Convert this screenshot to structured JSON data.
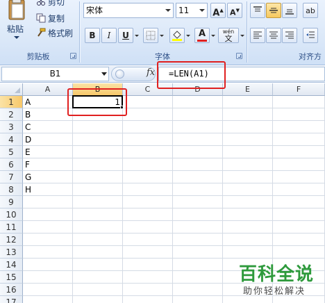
{
  "ribbon": {
    "clipboard": {
      "paste_label": "粘贴",
      "cut_label": "剪切",
      "copy_label": "复制",
      "format_painter_label": "格式刷",
      "group_label": "剪贴板"
    },
    "font": {
      "font_name": "宋体",
      "font_size": "11",
      "grow_label": "A",
      "shrink_label": "A",
      "bold_label": "B",
      "italic_label": "I",
      "underline_label": "U",
      "font_color_label": "A",
      "phonetic_label": "wén",
      "group_label": "字体",
      "font_color": "#e02020",
      "fill_color": "#ffff00"
    },
    "alignment": {
      "group_label": "对齐方"
    }
  },
  "formula_bar": {
    "name_box": "B1",
    "fx_label": "fx",
    "formula": "=LEN(A1)"
  },
  "grid": {
    "columns": [
      "A",
      "B",
      "C",
      "D",
      "E",
      "F"
    ],
    "selected_column": "B",
    "rows": [
      "1",
      "2",
      "3",
      "4",
      "5",
      "6",
      "7",
      "8",
      "9",
      "10",
      "11",
      "12",
      "13",
      "14",
      "15",
      "16",
      "17"
    ],
    "selected_row": "1",
    "column_a_values": [
      "A",
      "B",
      "C",
      "D",
      "E",
      "F",
      "G",
      "H"
    ],
    "b1_value": "1",
    "highlight_color": "#e02020"
  },
  "watermark": {
    "title": "百科全说",
    "subtitle": "助你轻松解决"
  }
}
